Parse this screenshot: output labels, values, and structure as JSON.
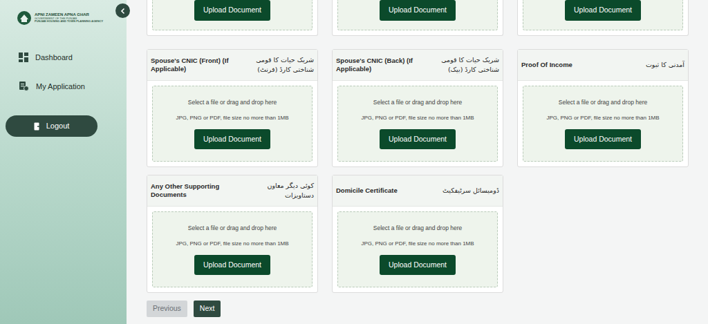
{
  "sidebar": {
    "logo": {
      "title": "APNI ZAMEEN APNA GHAR",
      "subtitle": "GOVERNMENT OF THE PUNJAB",
      "agency": "PUNJAB HOUSING AND TOWN PLANNING AGENCY"
    },
    "items": [
      {
        "label": "Dashboard",
        "selected": false
      },
      {
        "label": "My Application",
        "selected": false
      }
    ],
    "logout": "Logout"
  },
  "top_cards": [
    {
      "button": "Upload Document"
    },
    {
      "button": "Upload Document"
    },
    {
      "button": "Upload Document"
    }
  ],
  "cards": [
    {
      "title_en": "Spouse's CNIC (Front) (If Applicable)",
      "title_ur": "شریک حیات کا قومی شناختی کارڈ (فرنٹ)",
      "hint": "Select a file or drag and drop here",
      "formats": "JPG, PNG or PDF, file size no more than 1MB",
      "button": "Upload Document"
    },
    {
      "title_en": "Spouse's CNIC (Back) (If Applicable)",
      "title_ur": "شریک حیات کا قومی شناختی کارڈ (بیک)",
      "hint": "Select a file or drag and drop here",
      "formats": "JPG, PNG or PDF, file size no more than 1MB",
      "button": "Upload Document"
    },
    {
      "title_en": "Proof Of Income",
      "title_ur": "آمدنی کا ثبوت",
      "hint": "Select a file or drag and drop here",
      "formats": "JPG, PNG or PDF, file size no more than 1MB",
      "button": "Upload Document"
    },
    {
      "title_en": "Any Other Supporting Documents",
      "title_ur": "کوئی دیگر معاون دستاویزات",
      "hint": "Select a file or drag and drop here",
      "formats": "JPG, PNG or PDF, file size no more than 1MB",
      "button": "Upload Document"
    },
    {
      "title_en": "Domicile Certificate",
      "title_ur": "ڈومیسائل سرٹیفکیٹ",
      "hint": "Select a file or drag and drop here",
      "formats": "JPG, PNG or PDF, file size no more than 1MB",
      "button": "Upload Document"
    }
  ],
  "pager": {
    "previous": {
      "label": "Previous",
      "disabled": true
    },
    "next": {
      "label": "Next",
      "disabled": false
    }
  }
}
